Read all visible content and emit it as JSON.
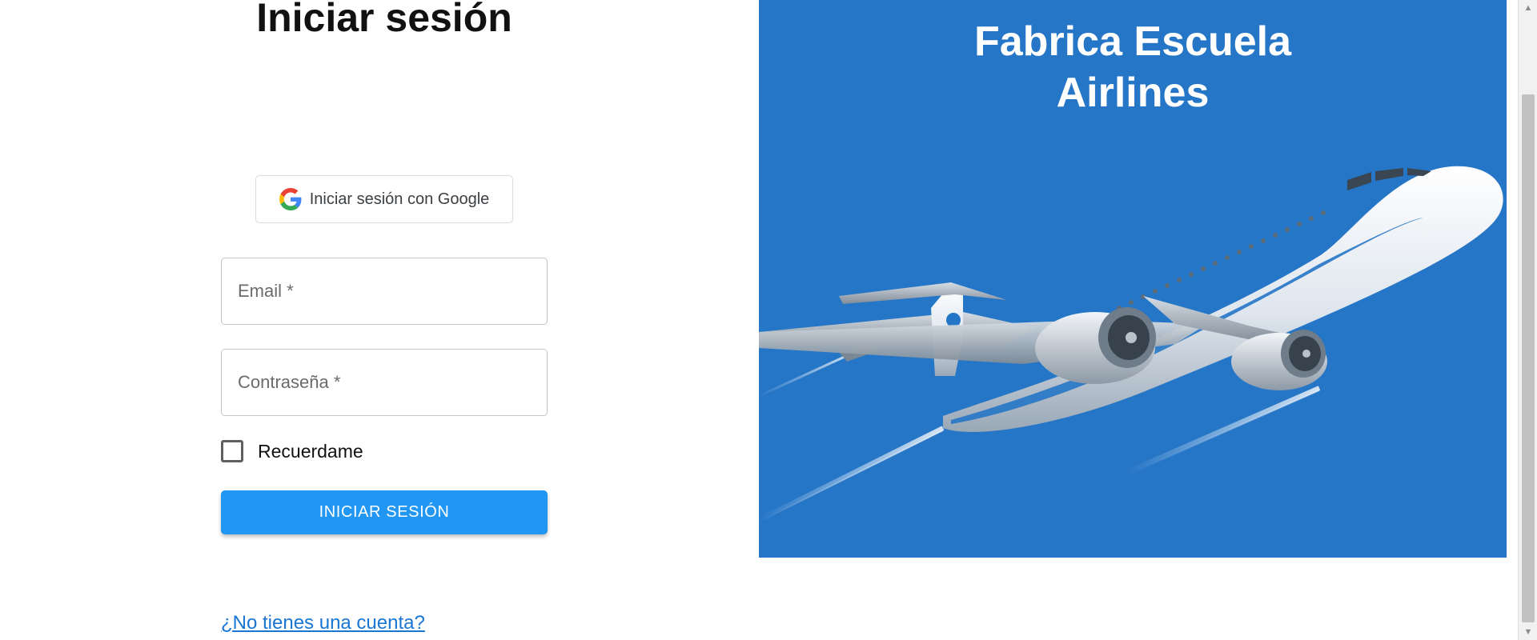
{
  "login": {
    "title": "Iniciar sesión",
    "google_button_label": "Iniciar sesión con Google",
    "email_placeholder": "Email *",
    "password_placeholder": "Contraseña *",
    "remember_label": "Recuerdame",
    "submit_label": "INICIAR SESIÓN",
    "signup_link": "¿No tienes una cuenta?"
  },
  "banner": {
    "title_line1": "Fabrica Escuela",
    "title_line2": "Airlines",
    "background_color": "#2676c7",
    "image": "airplane-illustration"
  },
  "colors": {
    "primary_button": "#2196f3",
    "link": "#1976d2"
  }
}
